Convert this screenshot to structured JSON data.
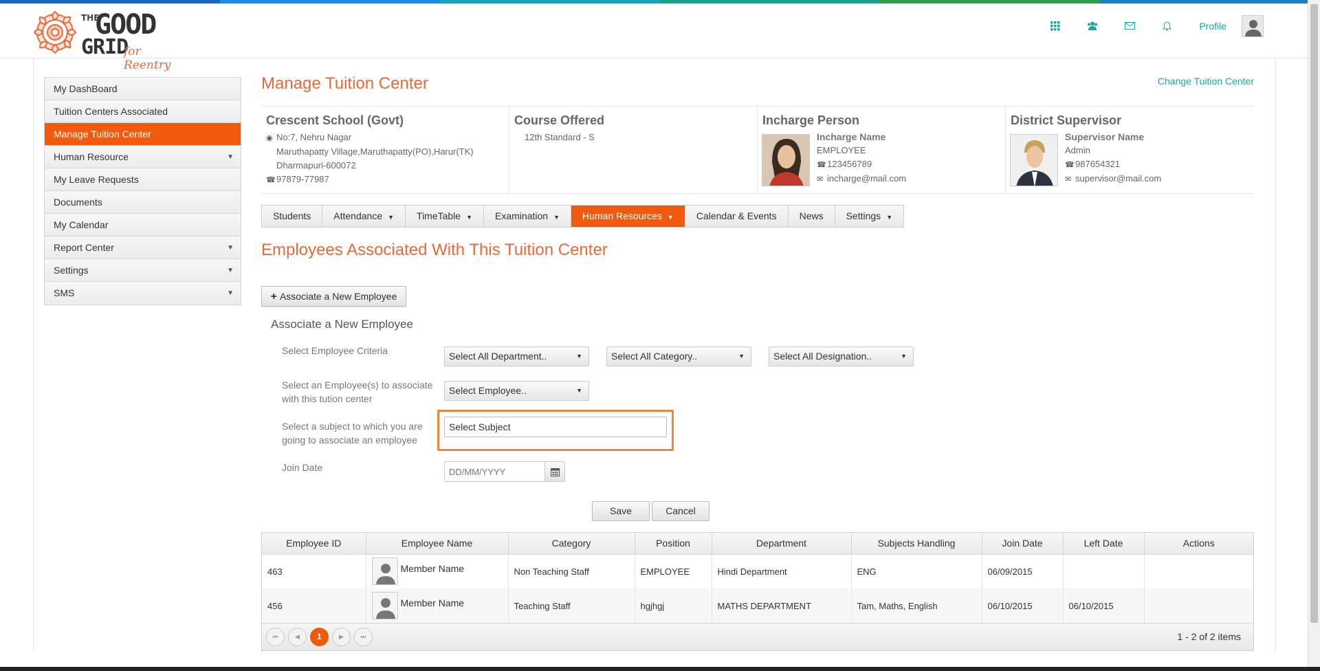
{
  "colors": {
    "accent": "#f15a0c",
    "teal": "#1ba6a1",
    "title": "#e8693a",
    "strip": [
      "#1565c0",
      "#1e88e5",
      "#1aa3b8",
      "#1aa08a",
      "#2e9e4a",
      "#1a7fc4"
    ]
  },
  "logo": {
    "the": "THE",
    "good": "GOOD",
    "grid": "GRID",
    "tagline": "for Reentry"
  },
  "header": {
    "icons": [
      "apps-grid-icon",
      "users-icon",
      "mail-icon",
      "bell-icon"
    ],
    "profile_label": "Profile"
  },
  "sidebar": {
    "items": [
      {
        "label": "My DashBoard",
        "caret": false,
        "active": false
      },
      {
        "label": "Tuition Centers Associated",
        "caret": false,
        "active": false
      },
      {
        "label": "Manage Tuition Center",
        "caret": false,
        "active": true
      },
      {
        "label": "Human Resource",
        "caret": true,
        "active": false
      },
      {
        "label": "My Leave Requests",
        "caret": false,
        "active": false
      },
      {
        "label": "Documents",
        "caret": false,
        "active": false
      },
      {
        "label": "My Calendar",
        "caret": false,
        "active": false
      },
      {
        "label": "Report Center",
        "caret": true,
        "active": false
      },
      {
        "label": "Settings",
        "caret": true,
        "active": false
      },
      {
        "label": "SMS",
        "caret": true,
        "active": false
      }
    ]
  },
  "page": {
    "title": "Manage Tuition Center",
    "change_link": "Change Tuition Center"
  },
  "school": {
    "name": "Crescent School (Govt)",
    "address1": "No:7, Nehru Nagar",
    "address2": "Maruthapatty Village,Maruthapatty(PO),Harur(TK)",
    "address3": "Dharmapuri-600072",
    "phone": "97879-77987"
  },
  "course": {
    "heading": "Course Offered",
    "value": "12th Standard - S"
  },
  "incharge": {
    "heading": "Incharge Person",
    "name": "Incharge Name",
    "role": "EMPLOYEE",
    "phone": "123456789",
    "email": "incharge@mail.com"
  },
  "supervisor": {
    "heading": "District Supervisor",
    "name": "Supervisor Name",
    "role": "Admin",
    "phone": "987654321",
    "email": "supervisor@mail.com"
  },
  "tabs": [
    {
      "label": "Students",
      "caret": false,
      "active": false
    },
    {
      "label": "Attendance",
      "caret": true,
      "active": false
    },
    {
      "label": "TimeTable",
      "caret": true,
      "active": false
    },
    {
      "label": "Examination",
      "caret": true,
      "active": false
    },
    {
      "label": "Human Resources",
      "caret": true,
      "active": true
    },
    {
      "label": "Calendar & Events",
      "caret": false,
      "active": false
    },
    {
      "label": "News",
      "caret": false,
      "active": false
    },
    {
      "label": "Settings",
      "caret": true,
      "active": false
    }
  ],
  "section": {
    "title": "Employees Associated With This Tuition Center",
    "assoc_button": "Associate a New Employee"
  },
  "form": {
    "title": "Associate a New Employee",
    "criteria_label": "Select Employee Criteria",
    "department_dd": "Select All Department..",
    "category_dd": "Select All Category..",
    "designation_dd": "Select All Designation..",
    "employee_label_1": "Select an Employee(s) to associate",
    "employee_label_2": "with this tution center",
    "employee_dd": "Select Employee..",
    "subject_label_1": "Select a subject to which you are",
    "subject_label_2": "going to associate an employee",
    "subject_value": "Select Subject",
    "join_label": "Join Date",
    "join_placeholder": "DD/MM/YYYY",
    "save": "Save",
    "cancel": "Cancel"
  },
  "grid": {
    "columns": [
      "Employee ID",
      "Employee Name",
      "Category",
      "Position",
      "Department",
      "Subjects Handling",
      "Join Date",
      "Left Date",
      "Actions"
    ],
    "rows": [
      {
        "id": "463",
        "name": "Member Name",
        "category": "Non Teaching Staff",
        "position": "EMPLOYEE",
        "department": "Hindi Department",
        "subjects": "ENG",
        "join": "06/09/2015",
        "left": "",
        "actions": ""
      },
      {
        "id": "456",
        "name": "Member Name",
        "category": "Teaching Staff",
        "position": "hgjhgj",
        "department": "MATHS DEPARTMENT",
        "subjects": "Tam, Maths, English",
        "join": "06/10/2015",
        "left": "06/10/2015",
        "actions": ""
      }
    ],
    "current_page": "1",
    "pager_info": "1 - 2 of 2 items"
  }
}
